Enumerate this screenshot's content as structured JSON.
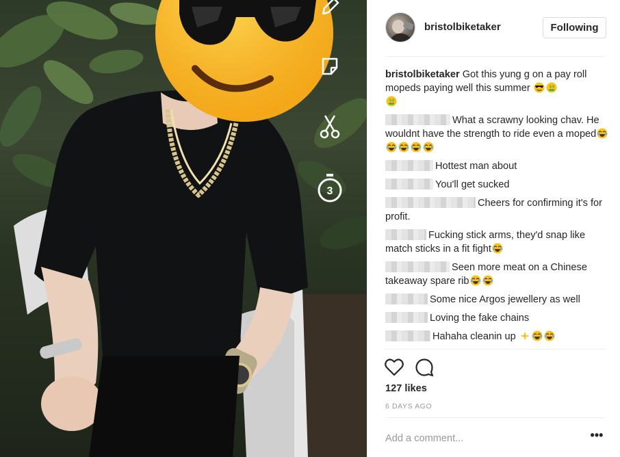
{
  "post": {
    "username": "bristolbiketaker",
    "follow_label": "Following",
    "caption": "Got this yung g on a pay roll mopeds paying well this summer",
    "caption_emoji": [
      "sunglasses-face-emoji",
      "money-mouth-emoji",
      "money-mouth-emoji"
    ],
    "likes": "127 likes",
    "timestamp": "6 DAYS AGO",
    "add_comment_placeholder": "Add a comment...",
    "more_label": "•••"
  },
  "comments": [
    {
      "text": "What a scrawny looking chav. He wouldnt have the strength to ride even a moped",
      "emoji": [
        "joy-emoji",
        "joy-emoji",
        "joy-emoji",
        "joy-emoji",
        "joy-emoji"
      ]
    },
    {
      "text": "Hottest man about",
      "emoji": []
    },
    {
      "text": "You'll get sucked",
      "emoji": []
    },
    {
      "text": "Cheers for confirming it's for profit.",
      "emoji": []
    },
    {
      "text": "Fucking stick arms, they'd snap like match sticks in a fit fight",
      "emoji": [
        "joy-emoji"
      ]
    },
    {
      "text": "Seen more meat on a Chinese takeaway spare rib",
      "emoji": [
        "joy-emoji",
        "joy-emoji"
      ]
    },
    {
      "text": "Some nice Argos jewellery as well",
      "emoji": []
    },
    {
      "text": "Loving the fake chains",
      "emoji": []
    },
    {
      "text": "Hahaha cleanin up",
      "emoji": [
        "sparkles-emoji",
        "joy-emoji",
        "joy-emoji"
      ]
    }
  ],
  "story_tools": [
    "pencil-icon",
    "sticker-icon",
    "scissors-icon",
    "timer-icon"
  ],
  "timer_label": "3",
  "colors": {
    "text": "#262626",
    "muted": "#999999",
    "border": "#dbdbdb",
    "emoji_yellow": "#f7c21a"
  }
}
